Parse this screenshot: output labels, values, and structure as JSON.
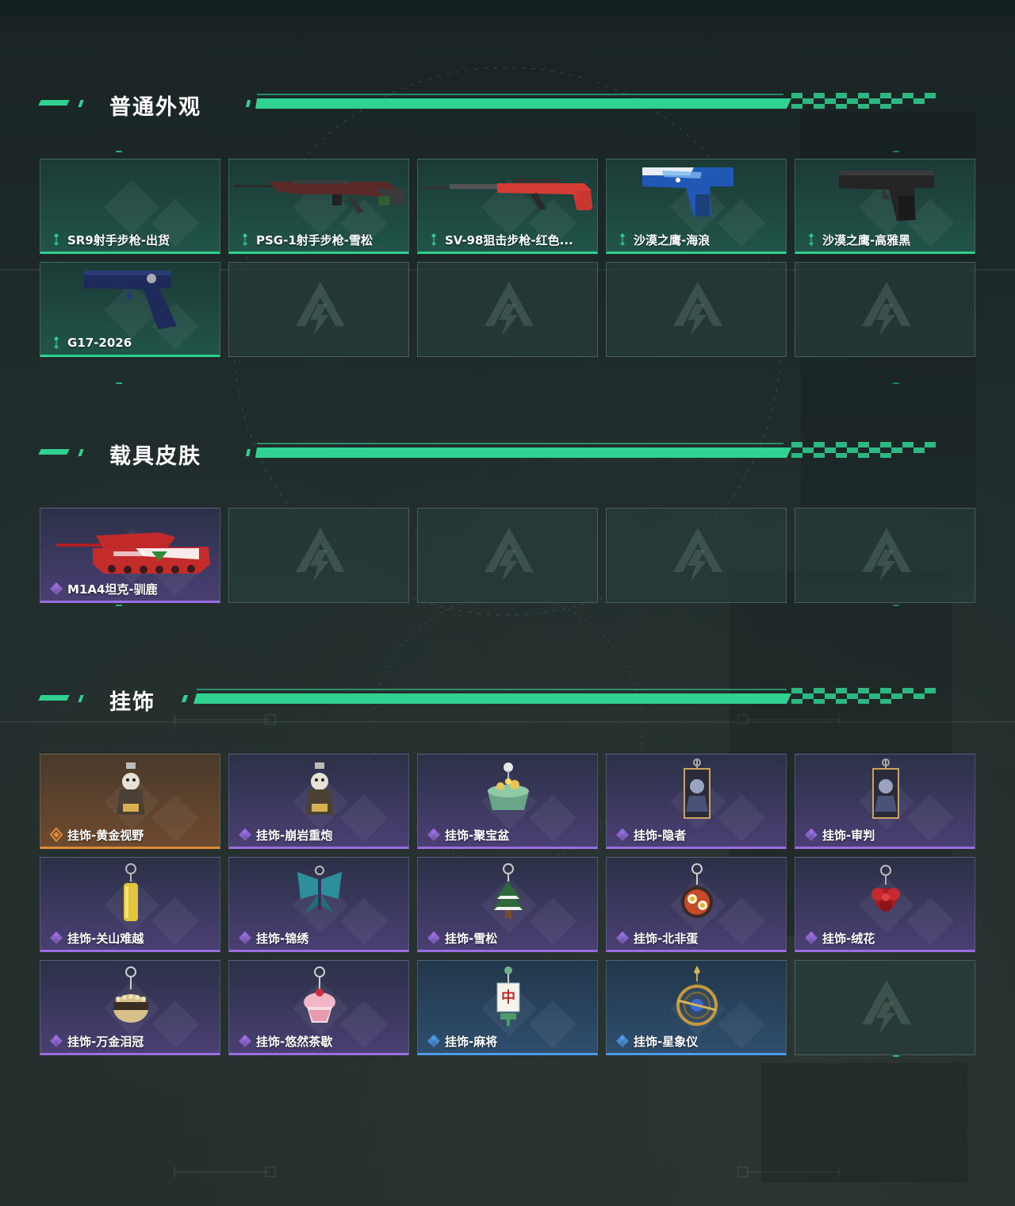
{
  "sections": [
    {
      "title": "普通外观",
      "items": [
        {
          "name": "SR9射手步枪-出货",
          "rarity": "green",
          "icon": "none"
        },
        {
          "name": "PSG-1射手步枪-雪松",
          "rarity": "green",
          "icon": "sniper-rifle-dark"
        },
        {
          "name": "SV-98狙击步枪-红色...",
          "rarity": "green",
          "icon": "sniper-rifle-red"
        },
        {
          "name": "沙漠之鹰-海浪",
          "rarity": "green",
          "icon": "pistol-blue"
        },
        {
          "name": "沙漠之鹰-高雅黑",
          "rarity": "green",
          "icon": "pistol-black"
        },
        {
          "name": "G17-2026",
          "rarity": "green",
          "icon": "pistol-navy"
        },
        {
          "name": "",
          "rarity": "empty"
        },
        {
          "name": "",
          "rarity": "empty"
        },
        {
          "name": "",
          "rarity": "empty"
        },
        {
          "name": "",
          "rarity": "empty"
        }
      ]
    },
    {
      "title": "载具皮肤",
      "items": [
        {
          "name": "M1A4坦克-驯鹿",
          "rarity": "purple",
          "icon": "tank-red"
        },
        {
          "name": "",
          "rarity": "empty"
        },
        {
          "name": "",
          "rarity": "empty"
        },
        {
          "name": "",
          "rarity": "empty"
        },
        {
          "name": "",
          "rarity": "empty"
        }
      ]
    },
    {
      "title": "挂饰",
      "items": [
        {
          "name": "挂饰-黄金视野",
          "rarity": "orange",
          "icon": "charm-figure"
        },
        {
          "name": "挂饰-崩岩重炮",
          "rarity": "purple",
          "icon": "charm-figure"
        },
        {
          "name": "挂饰-聚宝盆",
          "rarity": "purple",
          "icon": "charm-bowl"
        },
        {
          "name": "挂饰-隐者",
          "rarity": "purple",
          "icon": "charm-card"
        },
        {
          "name": "挂饰-审判",
          "rarity": "purple",
          "icon": "charm-card"
        },
        {
          "name": "挂饰-关山难越",
          "rarity": "purple",
          "icon": "charm-cylinder"
        },
        {
          "name": "挂饰-锦绣",
          "rarity": "purple",
          "icon": "charm-butterfly"
        },
        {
          "name": "挂饰-雪松",
          "rarity": "purple",
          "icon": "charm-tree"
        },
        {
          "name": "挂饰-北非蛋",
          "rarity": "purple",
          "icon": "charm-pan"
        },
        {
          "name": "挂饰-绒花",
          "rarity": "purple",
          "icon": "charm-flower"
        },
        {
          "name": "挂饰-万金泪冠",
          "rarity": "purple",
          "icon": "charm-crown"
        },
        {
          "name": "挂饰-悠然茶歇",
          "rarity": "purple",
          "icon": "charm-cupcake"
        },
        {
          "name": "挂饰-麻将",
          "rarity": "blue",
          "icon": "charm-mahjong"
        },
        {
          "name": "挂饰-星象仪",
          "rarity": "blue",
          "icon": "charm-astrolabe"
        },
        {
          "name": "",
          "rarity": "empty"
        }
      ]
    }
  ],
  "colors": {
    "accent": "#2fd290",
    "green": "#2fcf8e",
    "purple": "#9a6ee0",
    "orange": "#e08a3c",
    "blue": "#4d9ae6"
  }
}
